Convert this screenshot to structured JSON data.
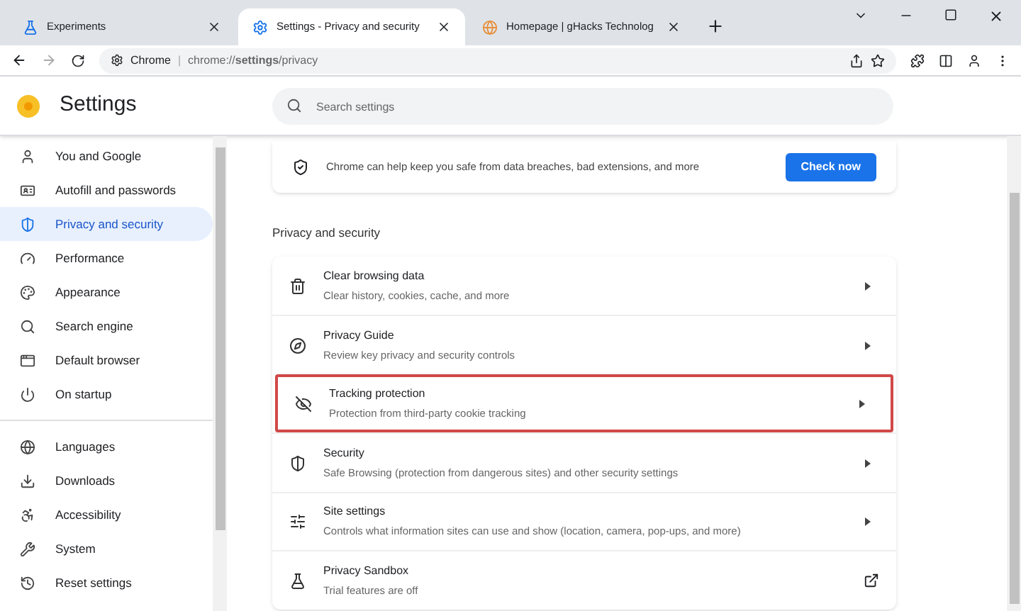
{
  "tabs": [
    {
      "title": "Experiments",
      "selected": false
    },
    {
      "title": "Settings - Privacy and security",
      "selected": true
    },
    {
      "title": "Homepage | gHacks Technolog",
      "selected": false
    }
  ],
  "address_bar": {
    "site": "Chrome",
    "separator": "|",
    "url": "chrome://**settings**/privacy"
  },
  "header": {
    "title": "Settings",
    "search_placeholder": "Search settings"
  },
  "sidebar": {
    "groups": [
      [
        {
          "label": "You and Google",
          "selected": false
        },
        {
          "label": "Autofill and passwords",
          "selected": false
        },
        {
          "label": "Privacy and security",
          "selected": true
        },
        {
          "label": "Performance",
          "selected": false
        },
        {
          "label": "Appearance",
          "selected": false
        },
        {
          "label": "Search engine",
          "selected": false
        },
        {
          "label": "Default browser",
          "selected": false
        },
        {
          "label": "On startup",
          "selected": false
        }
      ],
      [
        {
          "label": "Languages",
          "selected": false
        },
        {
          "label": "Downloads",
          "selected": false
        },
        {
          "label": "Accessibility",
          "selected": false
        },
        {
          "label": "System",
          "selected": false
        },
        {
          "label": "Reset settings",
          "selected": false
        }
      ]
    ]
  },
  "safety_check": {
    "text": "Chrome can help keep you safe from data breaches, bad extensions, and more",
    "button": "Check now"
  },
  "section_title": "Privacy and security",
  "rows": [
    {
      "title": "Clear browsing data",
      "subtitle": "Clear history, cookies, cache, and more",
      "kind": "arrow",
      "highlighted": false
    },
    {
      "title": "Privacy Guide",
      "subtitle": "Review key privacy and security controls",
      "kind": "arrow",
      "highlighted": false
    },
    {
      "title": "Tracking protection",
      "subtitle": "Protection from third-party cookie tracking",
      "kind": "arrow",
      "highlighted": true
    },
    {
      "title": "Security",
      "subtitle": "Safe Browsing (protection from dangerous sites) and other security settings",
      "kind": "arrow",
      "highlighted": false
    },
    {
      "title": "Site settings",
      "subtitle": "Controls what information sites can use and show (location, camera, pop-ups, and more)",
      "kind": "arrow",
      "highlighted": false
    },
    {
      "title": "Privacy Sandbox",
      "subtitle": "Trial features are off",
      "kind": "external",
      "highlighted": false
    }
  ]
}
